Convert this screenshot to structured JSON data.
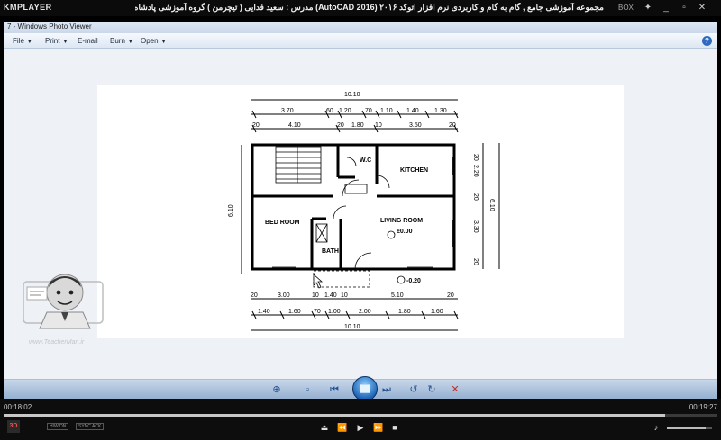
{
  "player": {
    "logo": "KMPLAYER",
    "title": "مجموعه آموزشی جامع , گام به گام و کاربردی نرم افزار اتوکد ۲۰۱۶ (AutoCAD 2016) مدرس : سعید فدایی ( تیچرمن ) گروه آموزشی پادشاه گرافیست ها",
    "box_label": "BOX",
    "time_elapsed": "00:18:02",
    "time_total": "00:19:27",
    "progress": 0.927,
    "volume": 0.85,
    "tags": [
      "H/W/DN",
      "SYNC ACK"
    ],
    "threed_label": "3D"
  },
  "viewer": {
    "title": "7 - Windows Photo Viewer",
    "menu": [
      {
        "label": "File",
        "dropdown": true
      },
      {
        "label": "Print",
        "dropdown": true
      },
      {
        "label": "E-mail",
        "dropdown": false
      },
      {
        "label": "Burn",
        "dropdown": true
      },
      {
        "label": "Open",
        "dropdown": true
      }
    ],
    "help": "?"
  },
  "watermark": {
    "site": "www.TeacherMan.ir"
  },
  "plan": {
    "top_total": "10.10",
    "top_row1": [
      "3.70",
      "60",
      "1.20",
      "70",
      "1.10",
      "1.40",
      "1.30"
    ],
    "top_row2": [
      "20",
      "4.10",
      "20",
      "1.80",
      "10",
      "3.50",
      "20"
    ],
    "bottom_row1": [
      "20",
      "3.00",
      "10",
      "1.40",
      "10",
      "5.10",
      "20"
    ],
    "bottom_row2": [
      "1.40",
      "1.60",
      "70",
      "1.00",
      "2.00",
      "1.80",
      "1.60"
    ],
    "bottom_total": "10.10",
    "left_total": "6.10",
    "right_total": "6.10",
    "right_row": [
      "20",
      "2.20",
      "20",
      "3.30",
      "20"
    ],
    "rooms": {
      "wc": "W.C",
      "kitchen": "KITCHEN",
      "bedroom": "BED ROOM",
      "living": "LIVING ROOM",
      "bath": "BATH"
    },
    "level_inside": "±0.00",
    "level_outside": "-0.20"
  },
  "colors": {
    "accent": "#1e63b5",
    "player_bg": "#0b0b0b"
  }
}
